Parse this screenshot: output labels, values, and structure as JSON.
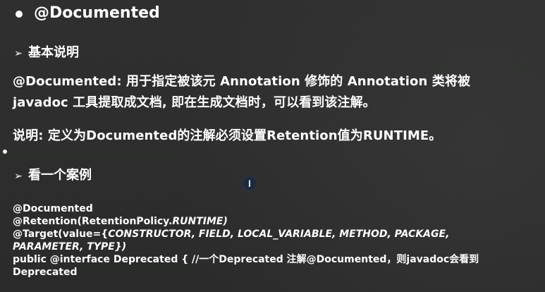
{
  "slide": {
    "title": "@Documented",
    "sections": [
      {
        "key": "basic",
        "label": "基本说明"
      },
      {
        "key": "example",
        "label": "看一个案例"
      }
    ],
    "basic_description": {
      "line1": "@Documented: 用于指定被该元 Annotation 修饰的 Annotation 类将被",
      "line2": "javadoc 工具提取成文档, 即在生成文档时，可以看到该注解。"
    },
    "note": "说明: 定义为Documented的注解必须设置Retention值为RUNTIME。",
    "code": {
      "line1": "@Documented",
      "line2_prefix": "@Retention(RetentionPolicy.",
      "line2_italic": "RUNTIME",
      "line2_suffix": ")",
      "line3_prefix": "@Target(value={",
      "line3_italic": "CONSTRUCTOR, FIELD, LOCAL_VARIABLE, METHOD, PACKAGE,",
      "line4_italic": "PARAMETER, TYPE})",
      "line5": "public @interface Deprecated { //一个Deprecated 注解@Documented，则javadoc会看到",
      "line6": "Deprecated"
    },
    "ui": {
      "text_cursor_glyph": "I"
    }
  }
}
